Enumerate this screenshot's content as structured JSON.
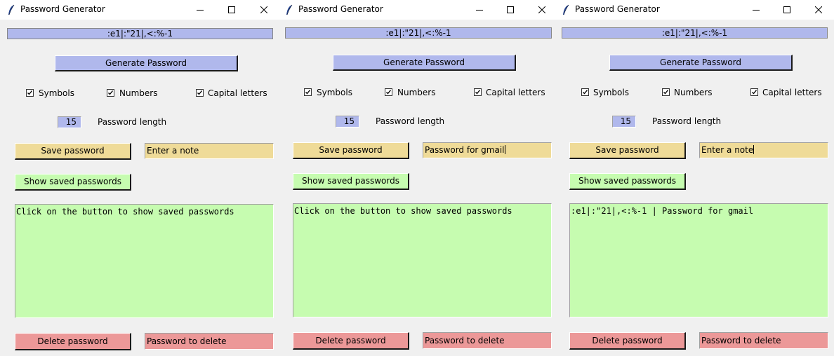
{
  "windows": [
    {
      "title": "Password Generator",
      "generated_password": ":e1|:\"21|,<:%-1",
      "generate_label": "Generate Password",
      "options": {
        "symbols": "Symbols",
        "numbers": "Numbers",
        "capitals": "Capital letters"
      },
      "options_checked": {
        "symbols": true,
        "numbers": true,
        "capitals": true
      },
      "length_value": "15",
      "length_label": "Password length",
      "save_label": "Save password",
      "note_value": "Enter a note",
      "show_label": "Show saved passwords",
      "saved_text": "Click on the button to show saved passwords",
      "delete_label": "Delete password",
      "delete_value": "Password to delete",
      "note_focused": false
    },
    {
      "title": "Password Generator",
      "generated_password": ":e1|:\"21|,<:%-1",
      "generate_label": "Generate Password",
      "options": {
        "symbols": "Symbols",
        "numbers": "Numbers",
        "capitals": "Capital letters"
      },
      "options_checked": {
        "symbols": true,
        "numbers": true,
        "capitals": true
      },
      "length_value": "15",
      "length_label": "Password length",
      "save_label": "Save password",
      "note_value": "Password for gmail",
      "show_label": "Show saved passwords",
      "saved_text": "Click on the button to show saved passwords",
      "delete_label": "Delete password",
      "delete_value": "Password to delete",
      "note_focused": true
    },
    {
      "title": "Password Generator",
      "generated_password": ":e1|:\"21|,<:%-1",
      "generate_label": "Generate Password",
      "options": {
        "symbols": "Symbols",
        "numbers": "Numbers",
        "capitals": "Capital letters"
      },
      "options_checked": {
        "symbols": true,
        "numbers": true,
        "capitals": true
      },
      "length_value": "15",
      "length_label": "Password length",
      "save_label": "Save password",
      "note_value": "Enter a note",
      "show_label": "Show saved passwords",
      "saved_text": ":e1|:\"21|,<:%-1 | Password for gmail",
      "delete_label": "Delete password",
      "delete_value": "Password to delete",
      "note_focused": true
    }
  ],
  "icons": {
    "app": "feather-icon",
    "minimize": "minimize-icon",
    "maximize": "maximize-icon",
    "close": "close-icon",
    "check": "checkmark-icon"
  },
  "colors": {
    "generate": "#b0b8ec",
    "save": "#efdb98",
    "show": "#c6fcb0",
    "delete": "#ec9898",
    "background": "#f0f0f0"
  }
}
